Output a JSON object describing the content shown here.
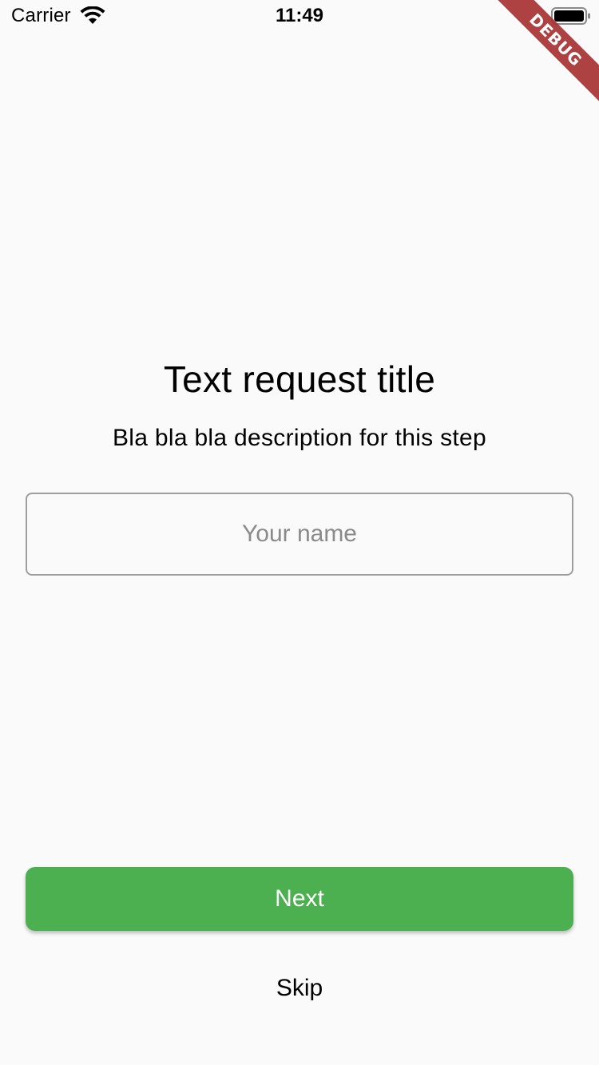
{
  "status_bar": {
    "carrier": "Carrier",
    "time": "11:49",
    "wifi_icon": "wifi-icon",
    "battery_icon": "battery-icon"
  },
  "debug_banner": {
    "label": "DEBUG",
    "color": "#a83232"
  },
  "step": {
    "title": "Text request title",
    "description": "Bla bla bla description for this step"
  },
  "name_field": {
    "value": "",
    "placeholder": "Your name"
  },
  "actions": {
    "next_label": "Next",
    "skip_label": "Skip",
    "accent_color": "#4caf50"
  }
}
